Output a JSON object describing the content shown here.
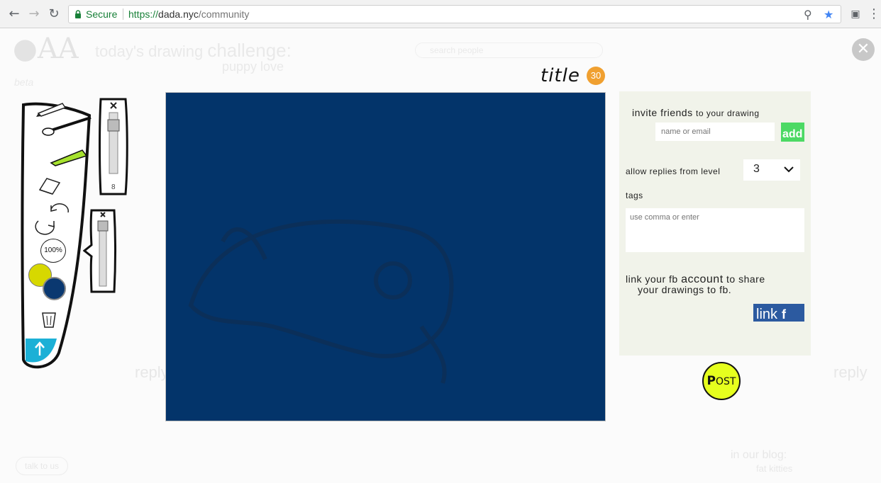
{
  "browser": {
    "secure_label": "Secure",
    "url_scheme": "https://",
    "url_host": "dada.nyc",
    "url_path": "/community"
  },
  "site": {
    "challenge_prefix": "today's drawing",
    "challenge_word": "challenge:",
    "challenge_topic": "puppy love",
    "beta_label": "beta",
    "search_placeholder": "search people",
    "reply_label": "reply",
    "talk_label": "talk to us",
    "blog_heading": "in our blog:",
    "blog_item": "fat kitties"
  },
  "editor": {
    "title_label": "title",
    "title_count": "30",
    "canvas_color": "#03346a",
    "brush_size": "8",
    "zoom_label": "100%",
    "primary_color": "#d7d800",
    "secondary_color": "#0a3870"
  },
  "panel": {
    "invite_heading": "invite friends",
    "invite_suffix": "to your drawing",
    "invite_placeholder": "name or email",
    "add_label": "add",
    "allow_label": "allow replies from level",
    "level_value": "3",
    "tags_label": "tags",
    "tags_placeholder": "use comma or enter",
    "fb_line1_a": "link your fb",
    "fb_line1_b": "account",
    "fb_line1_c": "to share",
    "fb_line2": "your drawings to fb.",
    "link_label": "link",
    "link_icon": "f"
  },
  "post": {
    "p": "P",
    "rest": "OST"
  },
  "colors": {
    "accent_green": "#4cd964",
    "fb_blue": "#2c5aa0",
    "post_yellow": "#e6ff1e",
    "count_orange": "#f0a030",
    "panel_bg": "#f1f3ea"
  }
}
